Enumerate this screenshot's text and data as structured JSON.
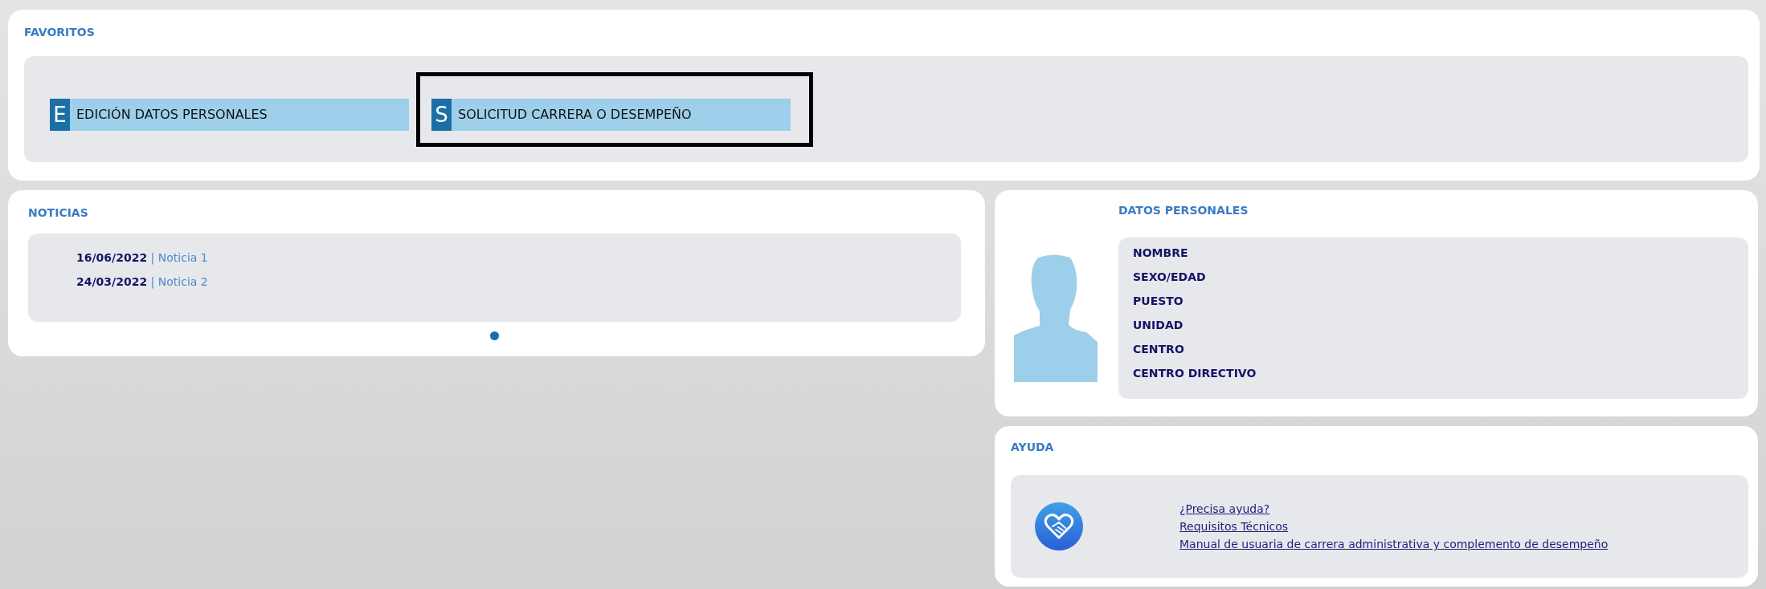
{
  "favoritos": {
    "title": "FAVORITOS",
    "items": [
      {
        "letter": "E",
        "label": "EDICIÓN DATOS PERSONALES",
        "highlighted": false
      },
      {
        "letter": "S",
        "label": "SOLICITUD CARRERA O DESEMPEÑO",
        "highlighted": true
      }
    ]
  },
  "noticias": {
    "title": "NOTICIAS",
    "items": [
      {
        "date": "16/06/2022",
        "separator": "|",
        "title": "Noticia 1"
      },
      {
        "date": "24/03/2022",
        "separator": "|",
        "title": "Noticia 2"
      }
    ],
    "pager": [
      {
        "selected": true
      }
    ]
  },
  "datos_personales": {
    "title": "DATOS PERSONALES",
    "fields": [
      "NOMBRE",
      "SEXO/EDAD",
      "PUESTO",
      "UNIDAD",
      "CENTRO",
      "CENTRO DIRECTIVO"
    ]
  },
  "ayuda": {
    "title": "AYUDA",
    "links": [
      "¿Precisa ayuda?",
      "Requisitos Técnicos",
      "Manual de usuaria de carrera administrativa y complemento de desempeño"
    ]
  }
}
